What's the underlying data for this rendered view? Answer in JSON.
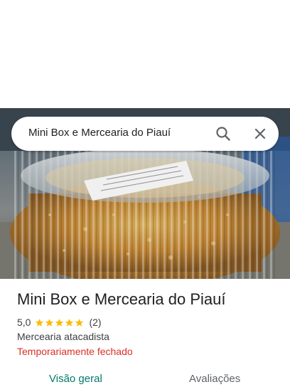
{
  "search": {
    "query": "Mini Box e Mercearia do Piauí",
    "search_icon": "search-icon",
    "close_icon": "close-icon"
  },
  "place": {
    "name": "Mini Box e Mercearia do Piauí",
    "rating": "5,0",
    "stars": 5,
    "review_count": "(2)",
    "category": "Mercearia atacadista",
    "status": "Temporariamente fechado"
  },
  "tabs": [
    {
      "label": "Visão geral",
      "selected": true
    },
    {
      "label": "Avaliações",
      "selected": false
    }
  ],
  "colors": {
    "accent": "#00796b",
    "closed": "#d93025",
    "star": "#fbbc04"
  }
}
